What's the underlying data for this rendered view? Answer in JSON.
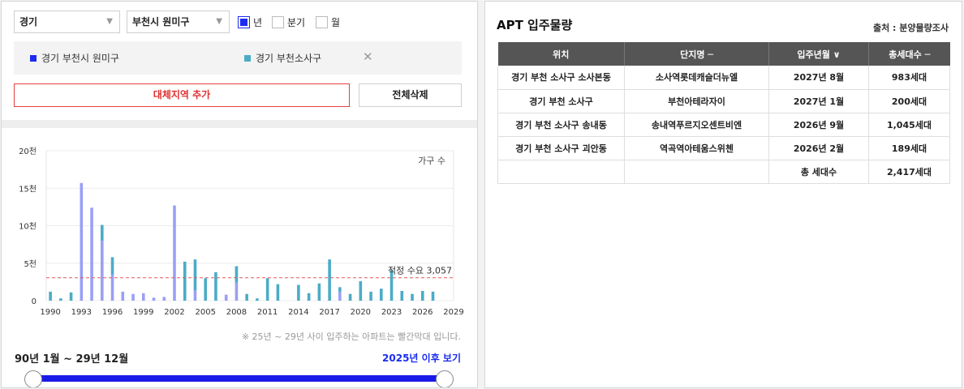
{
  "filters": {
    "province": "경기",
    "city": "부천시 원미구",
    "period_options": [
      {
        "label": "년",
        "checked": true
      },
      {
        "label": "분기",
        "checked": false
      },
      {
        "label": "월",
        "checked": false
      }
    ]
  },
  "regions": [
    {
      "label": "경기 부천시 원미구",
      "color": "#1a2cf0"
    },
    {
      "label": "경기 부천소사구",
      "color": "#4bacc6"
    }
  ],
  "buttons": {
    "remove_symbol": "✕",
    "add_region": "대체지역 추가",
    "delete_all": "전체삭제"
  },
  "chart_data": {
    "type": "bar",
    "ylabel_note": "가구 수",
    "y_ticks": [
      "20천",
      "15천",
      "10천",
      "5천",
      "0"
    ],
    "ylim": [
      0,
      20000
    ],
    "x_ticks": [
      "1990",
      "1993",
      "1996",
      "1999",
      "2002",
      "2005",
      "2008",
      "2011",
      "2014",
      "2017",
      "2020",
      "2023",
      "2026",
      "2029"
    ],
    "x": [
      1990,
      1991,
      1992,
      1993,
      1994,
      1995,
      1996,
      1997,
      1998,
      1999,
      2000,
      2001,
      2002,
      2003,
      2004,
      2005,
      2006,
      2007,
      2008,
      2009,
      2010,
      2011,
      2012,
      2013,
      2014,
      2015,
      2016,
      2017,
      2018,
      2019,
      2020,
      2021,
      2022,
      2023,
      2024,
      2025,
      2026,
      2027
    ],
    "series": [
      {
        "name": "경기 부천시 원미구",
        "color": "#9aa0f5",
        "values": [
          0,
          0,
          0,
          15700,
          12400,
          8000,
          3500,
          1200,
          900,
          1000,
          400,
          500,
          12700,
          0,
          1400,
          0,
          0,
          800,
          2400,
          0,
          0,
          0,
          0,
          0,
          0,
          0,
          0,
          0,
          1200,
          0,
          0,
          0,
          0,
          0,
          0,
          0,
          0,
          0
        ]
      },
      {
        "name": "경기 부천소사구",
        "color": "#4bacc6",
        "values": [
          1200,
          300,
          1100,
          0,
          0,
          2100,
          2300,
          0,
          0,
          0,
          0,
          0,
          0,
          5200,
          4100,
          3000,
          3800,
          0,
          2200,
          900,
          300,
          3000,
          2200,
          0,
          2100,
          1000,
          2300,
          5500,
          600,
          900,
          2600,
          1200,
          1600,
          4100,
          1300,
          900,
          1300,
          1200
        ]
      }
    ],
    "threshold": {
      "value": 3057,
      "label": "적정 수요 3,057",
      "color": "#e05a5a"
    },
    "grid": true
  },
  "footnote": "※ 25년 ~ 29년 사이 입주하는 아파트는 빨간막대 입니다.",
  "range": {
    "label": "90년 1월 ~ 29년 12월",
    "after_label": "2025년 이후 보기"
  },
  "supply_table": {
    "title": "APT 입주물량",
    "source": "출처 : 분양물량조사",
    "headers": [
      "위치",
      "단지명 ─",
      "입주년월 ∨",
      "총세대수 ─"
    ],
    "rows": [
      [
        "경기 부천 소사구 소사본동",
        "소사역롯데캐슬더뉴엘",
        "2027년 8월",
        "983세대"
      ],
      [
        "경기 부천 소사구",
        "부천아테라자이",
        "2027년 1월",
        "200세대"
      ],
      [
        "경기 부천 소사구 송내동",
        "송내역푸르지오센트비엔",
        "2026년 9월",
        "1,045세대"
      ],
      [
        "경기 부천 소사구 괴안동",
        "역곡역아테움스위첸",
        "2026년 2월",
        "189세대"
      ]
    ],
    "total_label": "총 세대수",
    "total_value": "2,417세대"
  }
}
